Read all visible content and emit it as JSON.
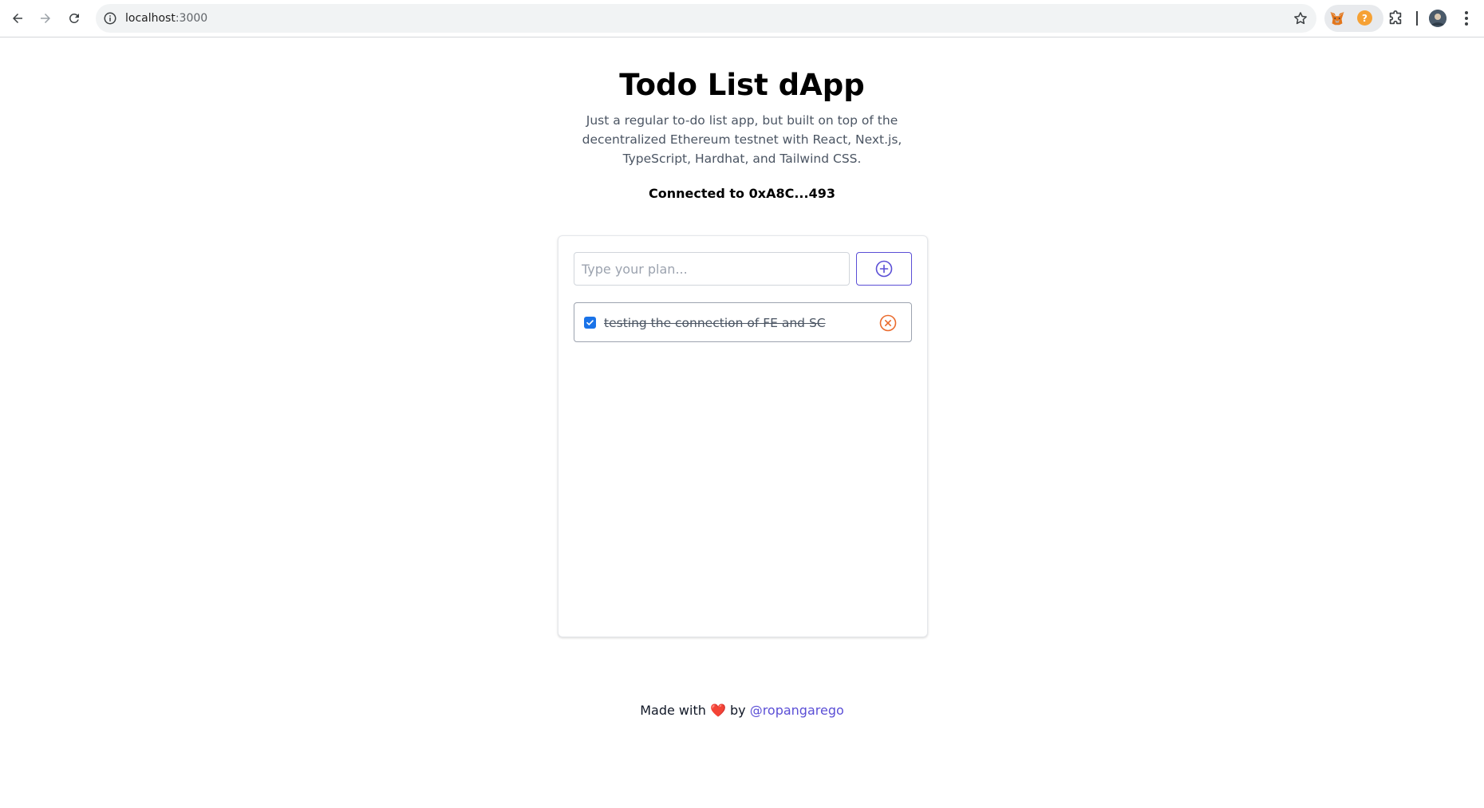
{
  "browser": {
    "url_host": "localhost",
    "url_port": ":3000",
    "icons": {
      "back": "arrow-left-icon",
      "forward": "arrow-right-icon",
      "reload": "reload-icon",
      "site_info": "info-icon",
      "bookmark": "star-icon",
      "extensions": [
        "metamask-fox-icon",
        "orange-extension-icon",
        "puzzle-icon"
      ],
      "profile": "avatar-icon",
      "menu": "kebab-menu-icon"
    },
    "orange_extension_glyph": "?"
  },
  "header": {
    "title": "Todo List dApp",
    "description": "Just a regular to-do list app, but built on top of the decentralized Ethereum testnet with React, Next.js, TypeScript, Hardhat, and Tailwind CSS.",
    "connected_label": "Connected to 0xA8C...493"
  },
  "todo_card": {
    "input_placeholder": "Type your plan...",
    "input_value": "",
    "add_button_icon": "plus-circle-icon",
    "items": [
      {
        "text": "testing the connection of FE and SC",
        "completed": true,
        "delete_icon": "x-circle-icon"
      }
    ]
  },
  "footer": {
    "prefix": "Made with",
    "heart": "❤️",
    "by": "by",
    "author": "@ropangarego"
  },
  "colors": {
    "accent": "#5b4fd6",
    "delete": "#ea6b2d",
    "checkbox": "#1a73e8",
    "muted_text": "#4b5563"
  }
}
